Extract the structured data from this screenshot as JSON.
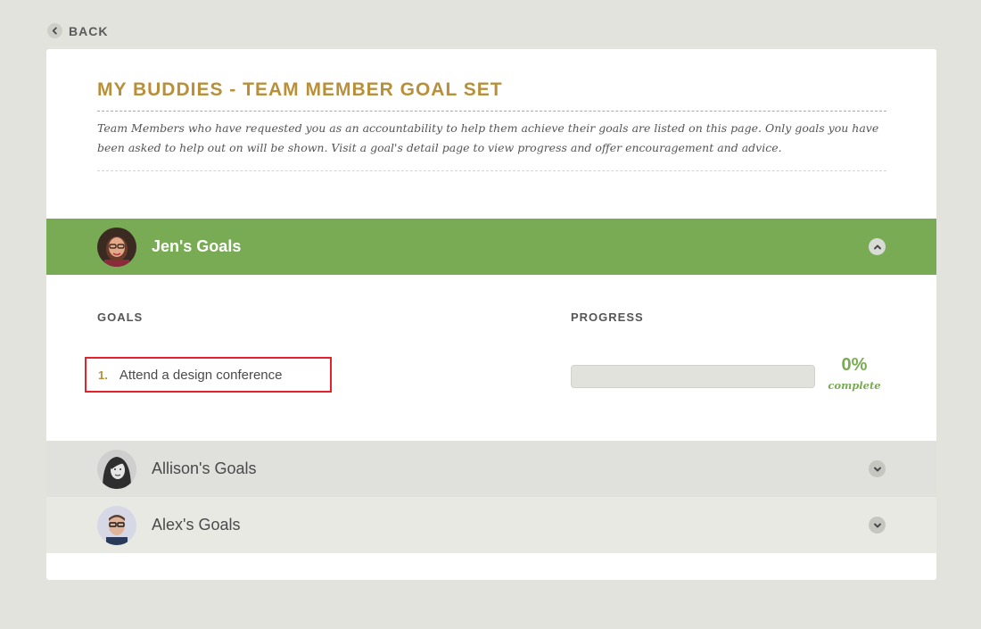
{
  "back": {
    "label": "BACK",
    "icon": "chevron-left-icon"
  },
  "page": {
    "title": "MY BUDDIES - TEAM MEMBER GOAL SET",
    "description": "Team Members who have requested you as an accountability to help them achieve their goals are listed on this page. Only goals you have been asked to help out on will be shown. Visit a goal's detail page to view progress and offer encouragement and advice."
  },
  "panels": [
    {
      "name": "Jen's Goals",
      "expanded": true,
      "toggle_icon": "chevron-up-icon",
      "columns": {
        "goals": "GOALS",
        "progress": "PROGRESS"
      },
      "goals": [
        {
          "number": "1.",
          "title": "Attend a design conference",
          "progress": 0,
          "progress_text": "0%",
          "progress_label": "complete"
        }
      ]
    },
    {
      "name": "Allison's Goals",
      "expanded": false,
      "toggle_icon": "chevron-down-icon"
    },
    {
      "name": "Alex's Goals",
      "expanded": false,
      "toggle_icon": "chevron-down-icon"
    }
  ],
  "colors": {
    "accent_green": "#78ab53",
    "title_gold": "#b8903c",
    "highlight_red": "#e5212b",
    "background": "#e3e3dd"
  }
}
